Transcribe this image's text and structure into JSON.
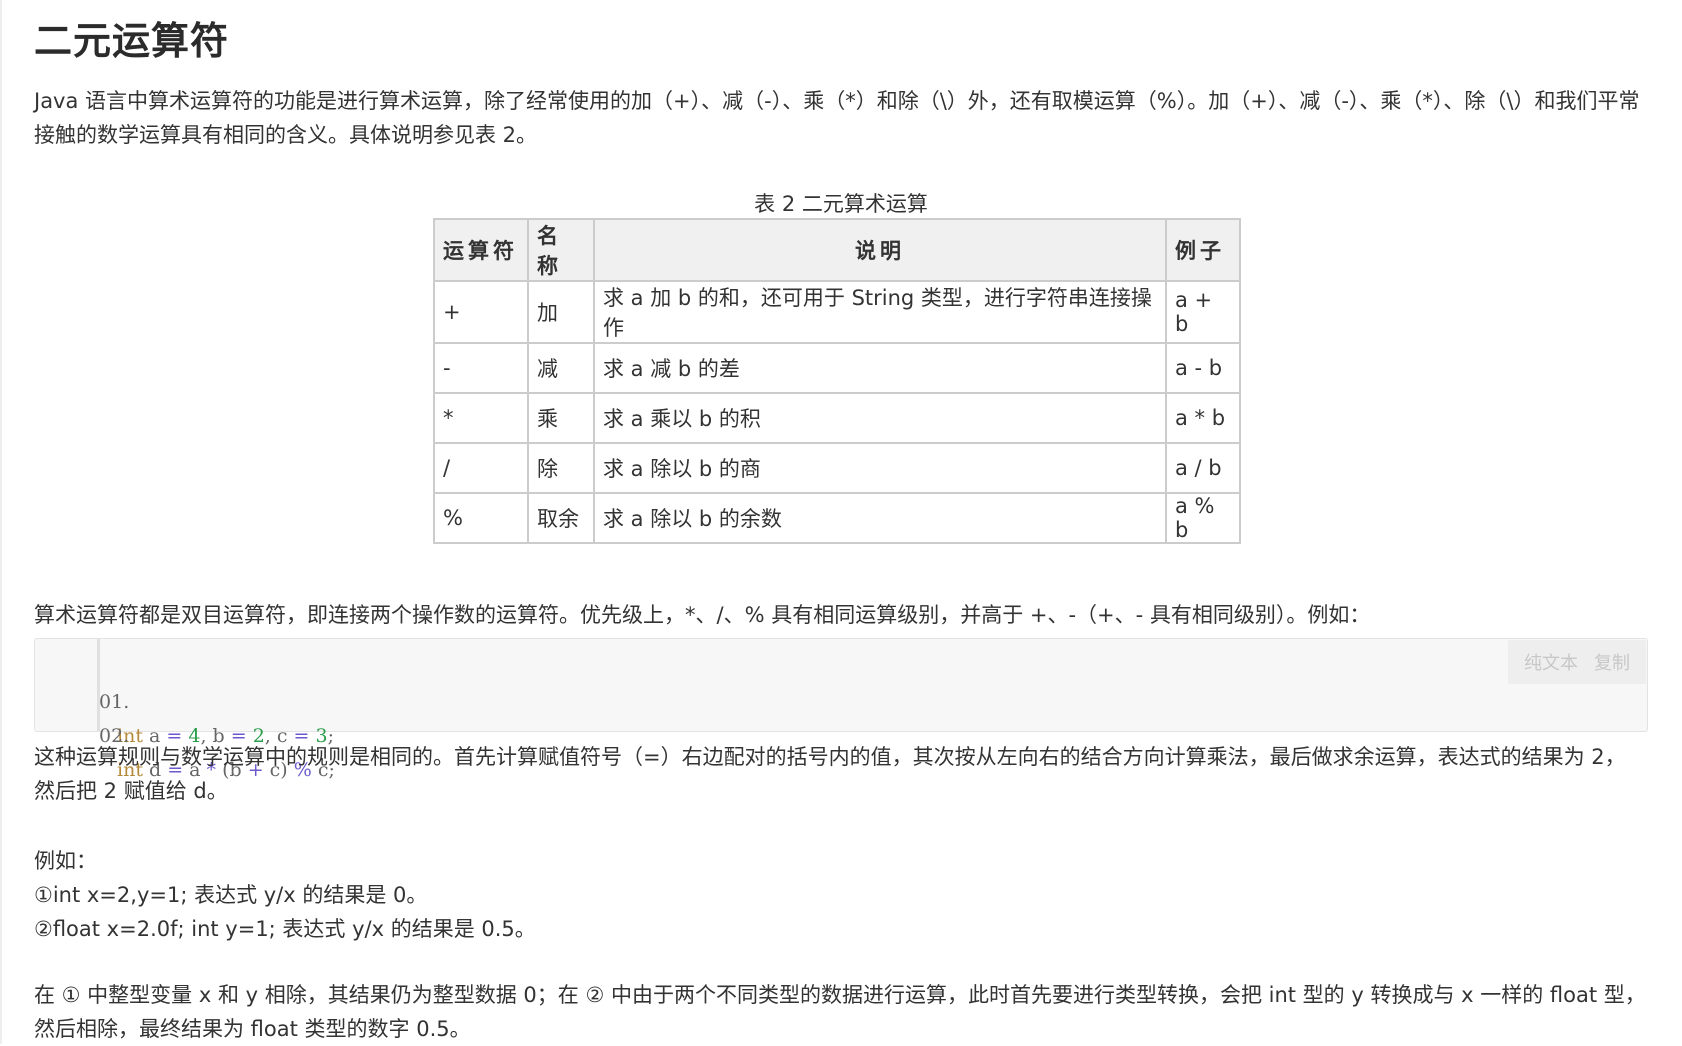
{
  "title": "二元运算符",
  "intro": "Java 语言中算术运算符的功能是进行算术运算，除了经常使用的加（+）、减（-）、乘（*）和除（\\）外，还有取模运算（%）。加（+）、减（-）、乘（*）、除（\\）和我们平常接触的数学运算具有相同的含义。具体说明参见表 2。",
  "table": {
    "caption": "表 2 二元算术运算",
    "headers": [
      "运算符",
      "名称",
      "说明",
      "例子"
    ],
    "rows": [
      {
        "op": "+",
        "name": "加",
        "desc": "求 a 加 b 的和，还可用于 String 类型，进行字符串连接操作",
        "example": "a + b"
      },
      {
        "op": "-",
        "name": "减",
        "desc": "求 a 减 b 的差",
        "example": "a - b"
      },
      {
        "op": "*",
        "name": "乘",
        "desc": "求 a 乘以 b 的积",
        "example": "a * b"
      },
      {
        "op": "/",
        "name": "除",
        "desc": "求 a 除以 b 的商",
        "example": "a / b"
      },
      {
        "op": "%",
        "name": "取余",
        "desc": "求 a 除以 b 的余数",
        "example": "a % b"
      }
    ]
  },
  "highlight": "算术运算符都是双目运算符，即连接两个操作数的运算符。优先级上，*、/、% 具有相同运算级别，并高于 +、-（+、- 具有相同级别）。例如：",
  "code": {
    "actions": {
      "plain": "纯文本",
      "copy": "复制"
    },
    "lines": [
      {
        "num": "01.",
        "tokens": [
          {
            "t": "int",
            "k": "kw"
          },
          {
            "t": " a ",
            "k": "id"
          },
          {
            "t": "=",
            "k": "op"
          },
          {
            "t": " ",
            "k": "id"
          },
          {
            "t": "4",
            "k": "num"
          },
          {
            "t": ", b ",
            "k": "id"
          },
          {
            "t": "=",
            "k": "op"
          },
          {
            "t": " ",
            "k": "id"
          },
          {
            "t": "2",
            "k": "num"
          },
          {
            "t": ", c ",
            "k": "id"
          },
          {
            "t": "=",
            "k": "op"
          },
          {
            "t": " ",
            "k": "id"
          },
          {
            "t": "3",
            "k": "num"
          },
          {
            "t": ";",
            "k": "id"
          }
        ]
      },
      {
        "num": "02.",
        "tokens": [
          {
            "t": "int",
            "k": "kw"
          },
          {
            "t": " d ",
            "k": "id"
          },
          {
            "t": "=",
            "k": "op"
          },
          {
            "t": " a ",
            "k": "id"
          },
          {
            "t": "*",
            "k": "op"
          },
          {
            "t": " (b ",
            "k": "id"
          },
          {
            "t": "+",
            "k": "op"
          },
          {
            "t": " c) ",
            "k": "id"
          },
          {
            "t": "%",
            "k": "op"
          },
          {
            "t": " c;",
            "k": "id"
          }
        ]
      }
    ]
  },
  "rule_para": "这种运算规则与数学运算中的规则是相同的。首先计算赋值符号（=）右边配对的括号内的值，其次按从左向右的结合方向计算乘法，最后做求余运算，表达式的结果为 2，然后把 2 赋值给 d。",
  "examples": {
    "label": "例如：",
    "items": [
      "①int x=2,y=1; 表达式 y/x 的结果是 0。",
      "②float x=2.0f; int y=1; 表达式 y/x 的结果是 0.5。"
    ]
  },
  "last_para": "在 ① 中整型变量 x 和 y 相除，其结果仍为整型数据 0；在 ② 中由于两个不同类型的数据进行运算，此时首先要进行类型转换，会把 int 型的 y 转换成与 x 一样的 float 型，然后相除，最终结果为 float 类型的数字 0.5。"
}
